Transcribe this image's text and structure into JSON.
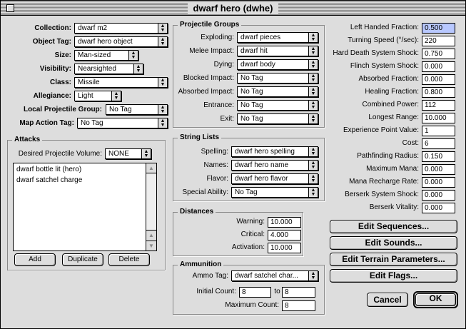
{
  "window": {
    "title": "dwarf hero (dwhe)"
  },
  "left": {
    "collection": {
      "label": "Collection:",
      "value": "dwarf m2"
    },
    "object_tag": {
      "label": "Object Tag:",
      "value": "dwarf hero object"
    },
    "size": {
      "label": "Size:",
      "value": "Man-sized"
    },
    "visibility": {
      "label": "Visibility:",
      "value": "Nearsighted"
    },
    "class": {
      "label": "Class:",
      "value": "Missile"
    },
    "allegiance": {
      "label": "Allegiance:",
      "value": "Light"
    },
    "local_projectile_group": {
      "label": "Local Projectile Group:",
      "value": "No Tag"
    },
    "map_action_tag": {
      "label": "Map Action Tag:",
      "value": "No Tag"
    }
  },
  "attacks": {
    "title": "Attacks",
    "desired_volume_label": "Desired Projectile Volume:",
    "desired_volume_value": "NONE",
    "items": [
      "dwarf bottle lit (hero)",
      "dwarf satchel charge"
    ],
    "add_label": "Add",
    "duplicate_label": "Duplicate",
    "delete_label": "Delete"
  },
  "projectile_groups": {
    "title": "Projectile Groups",
    "rows": [
      {
        "label": "Exploding:",
        "value": "dwarf pieces"
      },
      {
        "label": "Melee Impact:",
        "value": "dwarf hit"
      },
      {
        "label": "Dying:",
        "value": "dwarf body"
      },
      {
        "label": "Blocked Impact:",
        "value": "No Tag"
      },
      {
        "label": "Absorbed Impact:",
        "value": "No Tag"
      },
      {
        "label": "Entrance:",
        "value": "No Tag"
      },
      {
        "label": "Exit:",
        "value": "No Tag"
      }
    ]
  },
  "string_lists": {
    "title": "String Lists",
    "rows": [
      {
        "label": "Spelling:",
        "value": "dwarf hero spelling"
      },
      {
        "label": "Names:",
        "value": "dwarf hero name"
      },
      {
        "label": "Flavor:",
        "value": "dwarf hero flavor"
      },
      {
        "label": "Special Ability:",
        "value": "No Tag"
      }
    ]
  },
  "distances": {
    "title": "Distances",
    "rows": [
      {
        "label": "Warning:",
        "value": "10.000"
      },
      {
        "label": "Critical:",
        "value": "4.000"
      },
      {
        "label": "Activation:",
        "value": "10.000"
      }
    ]
  },
  "ammunition": {
    "title": "Ammunition",
    "ammo_tag_label": "Ammo Tag:",
    "ammo_tag_value": "dwarf satchel char...",
    "initial_count_label": "Initial Count:",
    "initial_count_from": "8",
    "to_label": "to",
    "initial_count_to": "8",
    "maximum_count_label": "Maximum Count:",
    "maximum_count_value": "8"
  },
  "right": {
    "rows": [
      {
        "label": "Left Handed Fraction:",
        "value": "0.500"
      },
      {
        "label": "Turning Speed (°/sec):",
        "value": "220"
      },
      {
        "label": "Hard Death System Shock:",
        "value": "0.750"
      },
      {
        "label": "Flinch System Shock:",
        "value": "0.000"
      },
      {
        "label": "Absorbed Fraction:",
        "value": "0.000"
      },
      {
        "label": "Healing Fraction:",
        "value": "0.800"
      },
      {
        "label": "Combined Power:",
        "value": "112"
      },
      {
        "label": "Longest Range:",
        "value": "10.000"
      },
      {
        "label": "Experience Point Value:",
        "value": "1"
      },
      {
        "label": "Cost:",
        "value": "6"
      },
      {
        "label": "Pathfinding Radius:",
        "value": "0.150"
      },
      {
        "label": "Maximum Mana:",
        "value": "0.000"
      },
      {
        "label": "Mana Recharge Rate:",
        "value": "0.000"
      },
      {
        "label": "Berserk System Shock:",
        "value": "0.000"
      },
      {
        "label": "Berserk Vitality:",
        "value": "0.000"
      }
    ]
  },
  "buttons": {
    "edit_sequences": "Edit Sequences...",
    "edit_sounds": "Edit Sounds...",
    "edit_terrain": "Edit Terrain Parameters...",
    "edit_flags": "Edit Flags...",
    "cancel": "Cancel",
    "ok": "OK"
  },
  "icons": {
    "popup_arrow": "updown-arrows-icon",
    "scroll_up": "scroll-up-arrow-icon",
    "scroll_down": "scroll-down-arrow-icon"
  }
}
